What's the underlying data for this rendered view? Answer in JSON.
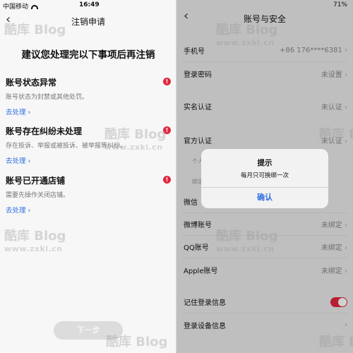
{
  "left": {
    "status": {
      "carrier": "中国移动",
      "time": "16:49"
    },
    "nav_title": "注销申请",
    "headline": "建议您处理完以下事项后再注销",
    "sections": [
      {
        "title": "账号状态异常",
        "desc": "账号状态为封禁或其他处罚。",
        "link": "去处理 ›"
      },
      {
        "title": "账号存在纠纷未处理",
        "desc": "存在投诉、举报或被投诉、被举报等纠纷。",
        "link": "去处理 ›"
      },
      {
        "title": "账号已开通店铺",
        "desc": "需要先操作关闭店铺。",
        "link": "去处理 ›"
      }
    ],
    "next_button": "下一步"
  },
  "right": {
    "status": {
      "battery": "71%"
    },
    "nav_title": "账号与安全",
    "group1": [
      {
        "label": "手机号",
        "value": "+86 176****6381"
      },
      {
        "label": "登录密码",
        "value": "未设置"
      }
    ],
    "group2": [
      {
        "label": "实名认证",
        "value": "未认证"
      }
    ],
    "group3": [
      {
        "label": "官方认证",
        "value": "未认证"
      }
    ],
    "group3_note": "个人",
    "group4_header": "绑定",
    "group4": [
      {
        "label": "微信",
        "value": ""
      },
      {
        "label": "微博账号",
        "value": "未绑定"
      },
      {
        "label": "QQ账号",
        "value": "未绑定"
      },
      {
        "label": "Apple账号",
        "value": "未绑定"
      }
    ],
    "group5": [
      {
        "label": "记住登录信息"
      },
      {
        "label": "登录设备信息",
        "value": ""
      }
    ],
    "dialog": {
      "title": "提示",
      "message": "每月只可换绑一次",
      "button": "确认"
    }
  },
  "watermark": {
    "line1": "酷库 Blog",
    "line2": "www.zxki.cn"
  }
}
